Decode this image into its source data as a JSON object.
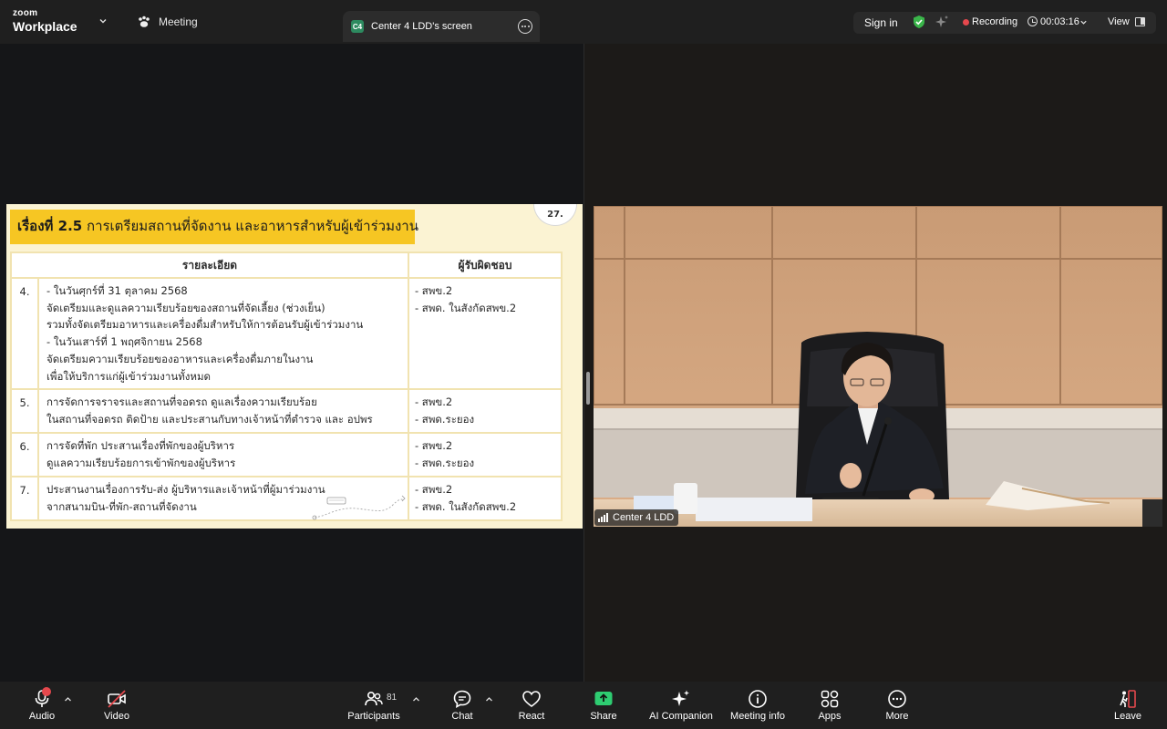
{
  "app": {
    "brand_small": "zoom",
    "brand_large": "Workplace"
  },
  "header": {
    "meeting_tab": "Meeting",
    "screen_tab_badge": "C4",
    "screen_tab_label": "Center 4 LDD's screen",
    "sign_in": "Sign in",
    "recording_label": "Recording",
    "timer": "00:03:16",
    "view_label": "View"
  },
  "slide": {
    "title_bold": "เรื่องที่ 2.5",
    "title_rest": "การเตรียมสถานที่จัดงาน และอาหารสำหรับผู้เข้าร่วมงาน",
    "page_number": "27.",
    "columns": [
      "รายละเอียด",
      "ผู้รับผิดชอบ"
    ],
    "rows": [
      {
        "no": "4.",
        "detail": [
          "- ในวันศุกร์ที่ 31 ตุลาคม 2568",
          "จัดเตรียมและดูแลความเรียบร้อยของสถานที่จัดเลี้ยง (ช่วงเย็น)",
          "รวมทั้งจัดเตรียมอาหารและเครื่องดื่มสำหรับให้การต้อนรับผู้เข้าร่วมงาน",
          "- ในวันเสาร์ที่ 1 พฤศจิกายน 2568",
          "จัดเตรียมความเรียบร้อยของอาหารและเครื่องดื่มภายในงาน",
          "เพื่อให้บริการแก่ผู้เข้าร่วมงานทั้งหมด"
        ],
        "resp": [
          "- สพข.2",
          "- สพด. ในสังกัดสพข.2"
        ]
      },
      {
        "no": "5.",
        "detail": [
          "การจัดการจราจรและสถานที่จอดรถ ดูแลเรื่องความเรียบร้อย",
          "ในสถานที่จอดรถ ติดป้าย และประสานกับทางเจ้าหน้าที่ตำรวจ และ อปพร"
        ],
        "resp": [
          "- สพข.2",
          "- สพด.ระยอง"
        ]
      },
      {
        "no": "6.",
        "detail": [
          "การจัดที่พัก ประสานเรื่องที่พักของผู้บริหาร",
          "ดูแลความเรียบร้อยการเข้าพักของผู้บริหาร"
        ],
        "resp": [
          "- สพข.2",
          "- สพด.ระยอง"
        ]
      },
      {
        "no": "7.",
        "detail": [
          "ประสานงานเรื่องการรับ-ส่ง ผู้บริหารและเจ้าหน้าที่ผู้มาร่วมงาน",
          "จากสนามบิน-ที่พัก-สถานที่จัดงาน"
        ],
        "resp": [
          "- สพข.2",
          "- สพด. ในสังกัดสพข.2"
        ]
      }
    ]
  },
  "video": {
    "participant_name": "Center 4 LDD"
  },
  "toolbar": {
    "audio": "Audio",
    "video": "Video",
    "participants": "Participants",
    "participants_count": "81",
    "chat": "Chat",
    "react": "React",
    "share": "Share",
    "ai_companion": "AI Companion",
    "meeting_info": "Meeting info",
    "apps": "Apps",
    "more": "More",
    "leave": "Leave"
  },
  "colors": {
    "share_green": "#2ecc71",
    "recording_red": "#e5484d",
    "shield_green": "#3ab54a",
    "slide_yellow": "#f6c623",
    "leave_red": "#e5484d"
  }
}
